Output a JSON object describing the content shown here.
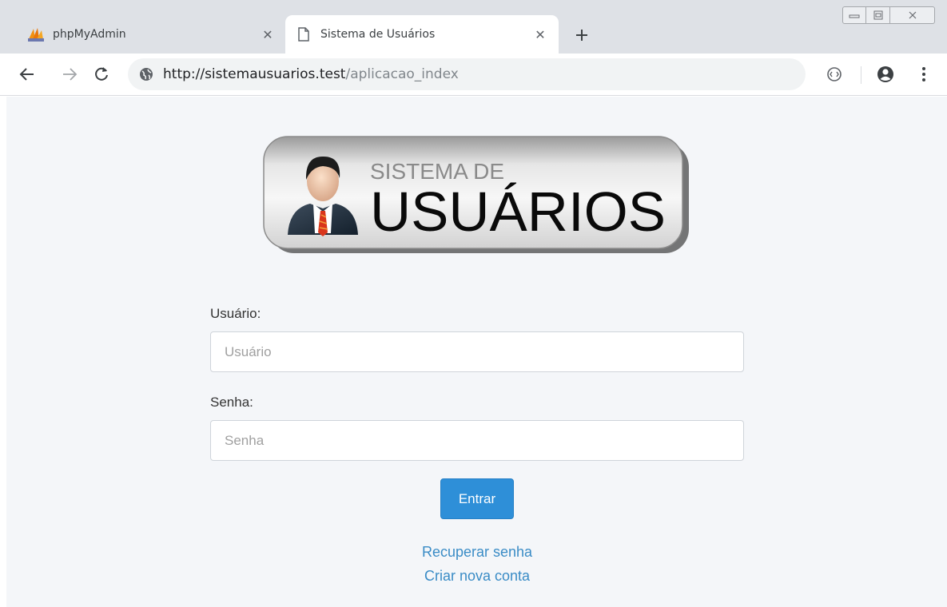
{
  "browser": {
    "tabs": [
      {
        "title": "phpMyAdmin",
        "active": false,
        "favicon": "phpmyadmin-icon"
      },
      {
        "title": "Sistema de Usuários",
        "active": true,
        "favicon": "page-icon"
      }
    ],
    "address": {
      "host": "http://sistemausuarios.test",
      "path": "/aplicacao_index"
    }
  },
  "logo": {
    "line1": "SISTEMA DE",
    "line2": "USUÁRIOS"
  },
  "form": {
    "user_label": "Usuário:",
    "user_placeholder": "Usuário",
    "password_label": "Senha:",
    "password_placeholder": "Senha",
    "submit_label": "Entrar"
  },
  "links": {
    "recover": "Recuperar senha",
    "create": "Criar nova conta"
  },
  "colors": {
    "button": "#2e8fd8",
    "link": "#3a8cc6",
    "page_bg": "#f4f6f9",
    "tabstrip": "#dee1e6"
  }
}
